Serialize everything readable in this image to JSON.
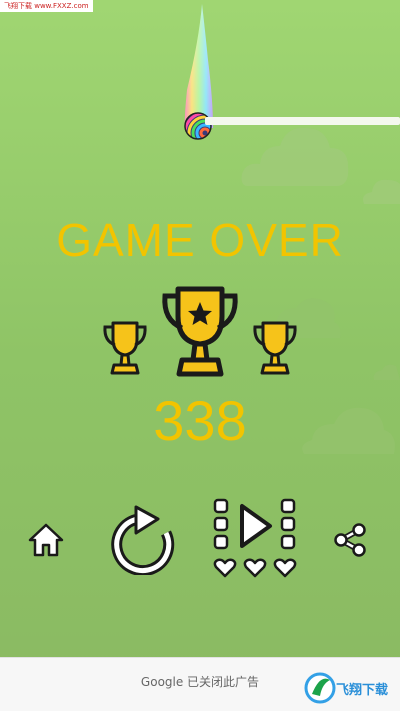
{
  "watermark": {
    "text": "飞翔下载 www.FXXZ.com"
  },
  "game": {
    "title": "GAME OVER",
    "score": "338"
  },
  "buttons": {
    "home": "home",
    "restart": "restart",
    "levels": "levels",
    "share": "share"
  },
  "ad": {
    "text": "Google  已关闭此广告",
    "logo_text": "飞翔下载"
  },
  "colors": {
    "background": "#96c96a",
    "title": "#f2c400",
    "trophy_gold": "#f6c31a",
    "icon_dark": "#1a1a1a"
  }
}
